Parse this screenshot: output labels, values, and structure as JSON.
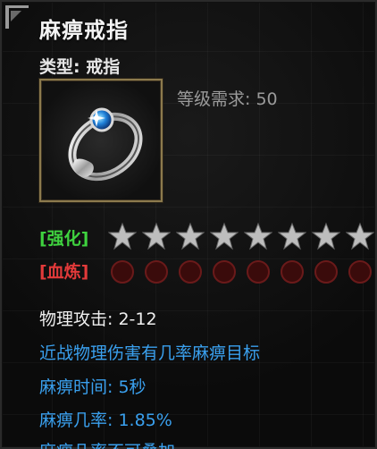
{
  "item": {
    "name": "麻痹戒指",
    "type_line": "类型: 戒指",
    "requirement": "等级需求: 50",
    "icon": "silver-ring-with-blue-gem-icon"
  },
  "enhance": {
    "label": "[强化]",
    "stars": 8,
    "star_color": "#bdbdbd"
  },
  "blood": {
    "label": "[血炼]",
    "slots": 8,
    "slot_color": "#3a0b0b"
  },
  "stats": {
    "attack": "物理攻击: 2-12"
  },
  "effects": [
    "近战物理伤害有几率麻痹目标",
    "麻痹时间: 5秒",
    "麻痹几率: 1.85%",
    "麻痹几率不可叠加"
  ],
  "colors": {
    "title": "#f4f4f4",
    "enhance": "#3fd23f",
    "blood": "#e23a3a",
    "effect": "#3aa0ee",
    "frame": "#8c7a4d"
  }
}
